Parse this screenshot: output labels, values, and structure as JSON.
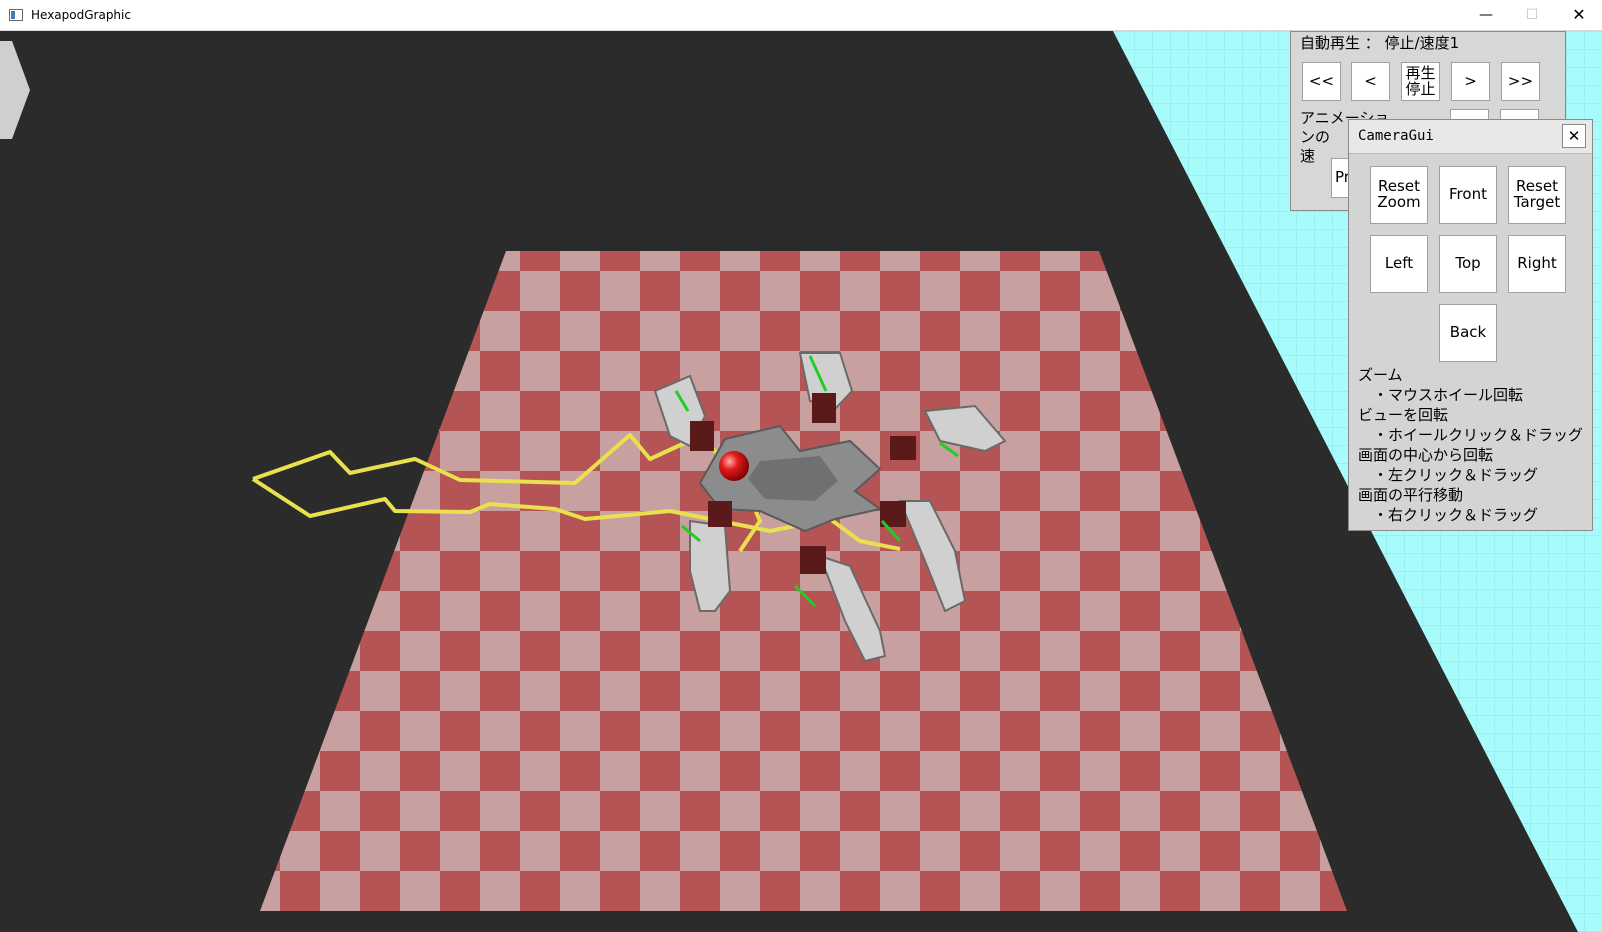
{
  "window": {
    "title": "HexapodGraphic",
    "minimize_glyph": "—",
    "maximize_glyph": "☐",
    "close_glyph": "✕"
  },
  "playback_panel": {
    "status_text": "自動再生 ： 停止/速度1",
    "buttons": {
      "first": "<<",
      "prev": "<",
      "play_stop": "再生\n停止",
      "next": ">",
      "last": ">>"
    },
    "speed_label": "アニメーションの\n速",
    "partial_button": "Pr"
  },
  "camera_gui": {
    "title": "CameraGui",
    "close_glyph": "✕",
    "buttons": {
      "reset_zoom": "Reset\nZoom",
      "front": "Front",
      "reset_target": "Reset\nTarget",
      "left": "Left",
      "top": "Top",
      "right": "Right",
      "back": "Back"
    },
    "help": [
      "ズーム",
      "　・マウスホイール回転",
      "ビューを回転",
      "　・ホイールクリック＆ドラッグ",
      "画面の中心から回転",
      "　・左クリック＆ドラッグ",
      "画面の平行移動",
      "　・右クリック＆ドラッグ"
    ]
  },
  "colors": {
    "background": "#2b2b2b",
    "floor_dark": "#b55454",
    "floor_light": "#c9a0a0",
    "wall": "#a8fbfb",
    "trajectory": "#e9e04f",
    "marker": "#e00000"
  }
}
